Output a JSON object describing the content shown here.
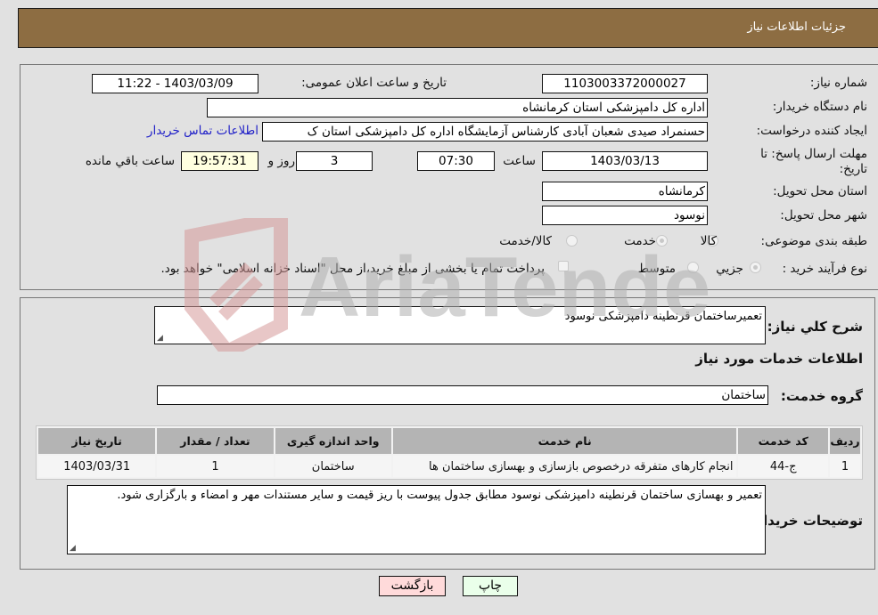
{
  "header": {
    "title": "جزئیات اطلاعات نیاز"
  },
  "form": {
    "need_number": {
      "label": "شماره نیاز:",
      "value": "1103003372000027"
    },
    "announce_datetime": {
      "label": "تاریخ و ساعت اعلان عمومی:",
      "value": "1403/03/09 - 11:22"
    },
    "buyer_org": {
      "label": "نام دستگاه خریدار:",
      "value": "اداره کل دامپزشکی استان کرمانشاه"
    },
    "requester": {
      "label": "ایجاد کننده درخواست:",
      "value": "حسنمراد صیدی شعبان آبادی کارشناس آزمایشگاه اداره کل دامپزشکی استان ک"
    },
    "buyer_contact_link": "اطلاعات تماس خریدار",
    "deadline": {
      "label": "مهلت ارسال پاسخ: تا تاریخ:",
      "date": "1403/03/13",
      "time_label": "ساعت",
      "time": "07:30",
      "days": "3",
      "days_label": "روز و",
      "remaining": "19:57:31",
      "remaining_label": "ساعت باقي مانده"
    },
    "province": {
      "label": "استان محل تحویل:",
      "value": "کرمانشاه"
    },
    "city": {
      "label": "شهر محل تحویل:",
      "value": "نوسود"
    },
    "category": {
      "label": "طبقه بندی موضوعی:",
      "options": [
        "کالا",
        "خدمت",
        "کالا/خدمت"
      ],
      "selected": "خدمت"
    },
    "purchase_type": {
      "label": "نوع فرآیند خرید :",
      "options": [
        "جزيي",
        "متوسط"
      ],
      "selected": "جزيي",
      "treasury_note": "پرداخت تمام یا بخشی از مبلغ خرید،از محل \"اسناد خزانه اسلامی\" خواهد بود.",
      "treasury_checked": false
    }
  },
  "details": {
    "summary_label": "شرح کلي نياز:",
    "summary_value": "تعمیرساختمان قرنطینه دامپزشکی نوسود",
    "services_heading": "اطلاعات خدمات مورد نیاز",
    "service_group_label": "گروه خدمت:",
    "service_group_value": "ساختمان",
    "table": {
      "headers": [
        "ردیف",
        "کد خدمت",
        "نام خدمت",
        "واحد اندازه گیری",
        "تعداد / مقدار",
        "تاریخ نیاز"
      ],
      "rows": [
        [
          "1",
          "ج-44",
          "انجام کارهای متفرقه درخصوص بازسازی و بهسازی ساختمان ها",
          "ساختمان",
          "1",
          "1403/03/31"
        ]
      ]
    },
    "buyer_notes_label": "توضیحات خریدار:",
    "buyer_notes_value": "تعمیر و بهسازی ساختمان قرنطینه دامپزشکی نوسود مطابق جدول پیوست با ریز قیمت و سایر مستندات مهر و امضاء و بارگزاری شود."
  },
  "buttons": {
    "print": "چاپ",
    "back": "بازگشت"
  },
  "watermark": {
    "text": "AriaTender.neT"
  }
}
